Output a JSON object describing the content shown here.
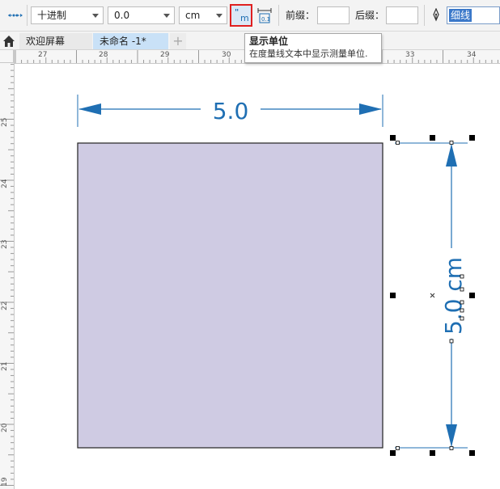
{
  "property_bar": {
    "number_format": "十进制",
    "precision": "0.0",
    "unit": "cm",
    "prefix_label": "前缀：",
    "suffix_label": "后缀：",
    "prefix_value": "",
    "suffix_value": "",
    "outline_width": "细线",
    "show_units_icon_text": "\"m",
    "text_position_icon_text": "0.1"
  },
  "tooltip": {
    "title": "显示单位",
    "description": "在度量线文本中显示测量单位."
  },
  "tabs": {
    "welcome": "欢迎屏幕",
    "document": "未命名 -1*",
    "add": "+"
  },
  "ruler": {
    "horizontal_ticks": [
      "27",
      "28",
      "29",
      "30",
      "33",
      "34"
    ],
    "vertical_ticks": [
      "25",
      "24",
      "23",
      "22",
      "21",
      "20",
      "19"
    ]
  },
  "canvas": {
    "horizontal_dimension": "5.0",
    "vertical_dimension": "5.0 cm",
    "rectangle_fill": "#cfcbe3",
    "dimension_color": "#1f6fb3",
    "selected_tool_outline": "#e02020"
  }
}
